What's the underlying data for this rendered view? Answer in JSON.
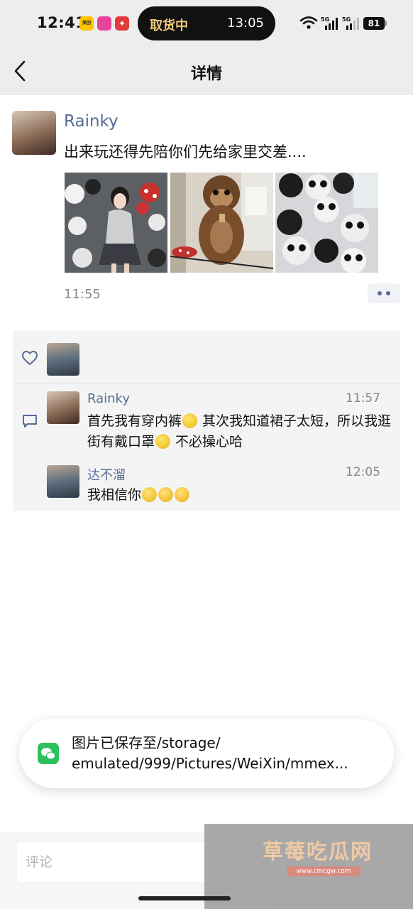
{
  "status_bar": {
    "time": "12:41",
    "app_badges": [
      "美团",
      "",
      "✦"
    ],
    "island_label": "取货中",
    "island_time": "13:05",
    "network_1": "5G",
    "network_2": "5G",
    "battery": "81",
    "icons": [
      "wifi-icon",
      "signal-icon",
      "battery-icon"
    ]
  },
  "header": {
    "title": "详情",
    "back_icon": "chevron-left-icon"
  },
  "post": {
    "author": "Rainky",
    "text": "出来玩还得先陪你们先给家里交差....",
    "time": "11:55",
    "photos": [
      "photo-girl-with-plushies",
      "photo-monkey-plush",
      "photo-panda-plushies"
    ],
    "more_icon": "more-dots-icon"
  },
  "interactions": {
    "like_icon": "heart-icon",
    "comment_icon": "comment-icon",
    "comments": [
      {
        "author": "Rainky",
        "time": "11:57",
        "text_part1": "首先我有穿内裤",
        "text_part2": " 其次我知道裙子太短，所以我逛街有戴口罩",
        "text_part3": " 不必操心哈"
      },
      {
        "author": "达不溜",
        "time": "12:05",
        "text": "我相信你"
      }
    ]
  },
  "toast": {
    "line1": "图片已保存至/storage/",
    "line2": "emulated/999/Pictures/WeiXin/mmex...",
    "icon": "wechat-icon"
  },
  "comment_box": {
    "placeholder": "评论"
  },
  "watermark": {
    "text": "草莓吃瓜网",
    "url": "www.cmcgw.com"
  },
  "colors": {
    "link_blue": "#576b95",
    "header_bg": "#ededed",
    "wechat_green": "#2dc15d"
  }
}
